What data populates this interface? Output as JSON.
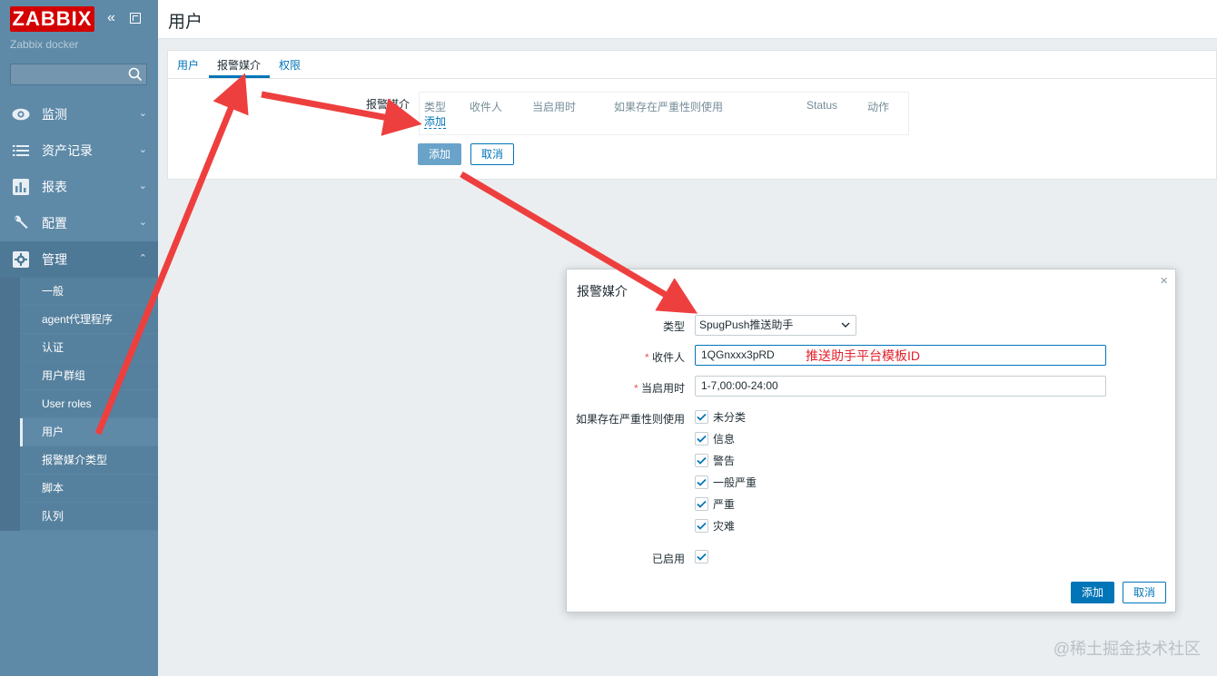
{
  "brand": {
    "logo": "ZABBIX",
    "server_name": "Zabbix docker"
  },
  "search": {
    "placeholder": ""
  },
  "menu": [
    {
      "label": "监测",
      "icon": "eye-icon",
      "chevron": "⌄"
    },
    {
      "label": "资产记录",
      "icon": "list-icon",
      "chevron": "⌄"
    },
    {
      "label": "报表",
      "icon": "chart-icon",
      "chevron": "⌄"
    },
    {
      "label": "配置",
      "icon": "wrench-icon",
      "chevron": "⌄"
    },
    {
      "label": "管理",
      "icon": "gear-icon",
      "chevron": "⌃"
    }
  ],
  "submenu": [
    "一般",
    "agent代理程序",
    "认证",
    "用户群组",
    "User roles",
    "用户",
    "报警媒介类型",
    "脚本",
    "队列"
  ],
  "page": {
    "title": "用户"
  },
  "tabs": [
    "用户",
    "报警媒介",
    "权限"
  ],
  "media_section": {
    "label": "报警媒介",
    "columns": [
      "类型",
      "收件人",
      "当启用时",
      "如果存在严重性则使用",
      "Status",
      "动作"
    ],
    "add_link": "添加",
    "add_button": "添加",
    "cancel_button": "取消"
  },
  "dialog": {
    "title": "报警媒介",
    "close": "×",
    "type_label": "类型",
    "type_value": "SpugPush推送助手",
    "sendto_label": "收件人",
    "sendto_value": "1QGnxxx3pRD",
    "sendto_annotation": "推送助手平台模板ID",
    "period_label": "当启用时",
    "period_value": "1-7,00:00-24:00",
    "severity_label": "如果存在严重性则使用",
    "severities": [
      "未分类",
      "信息",
      "警告",
      "一般严重",
      "严重",
      "灾难"
    ],
    "enabled_label": "已启用",
    "add_button": "添加",
    "cancel_button": "取消",
    "required_mark": "*"
  },
  "watermark": "@稀土掘金技术社区",
  "colors": {
    "sidebar": "#5e8aa8",
    "accent": "#0275b8",
    "logo": "#d40000",
    "arrow": "#ee3f3f"
  }
}
